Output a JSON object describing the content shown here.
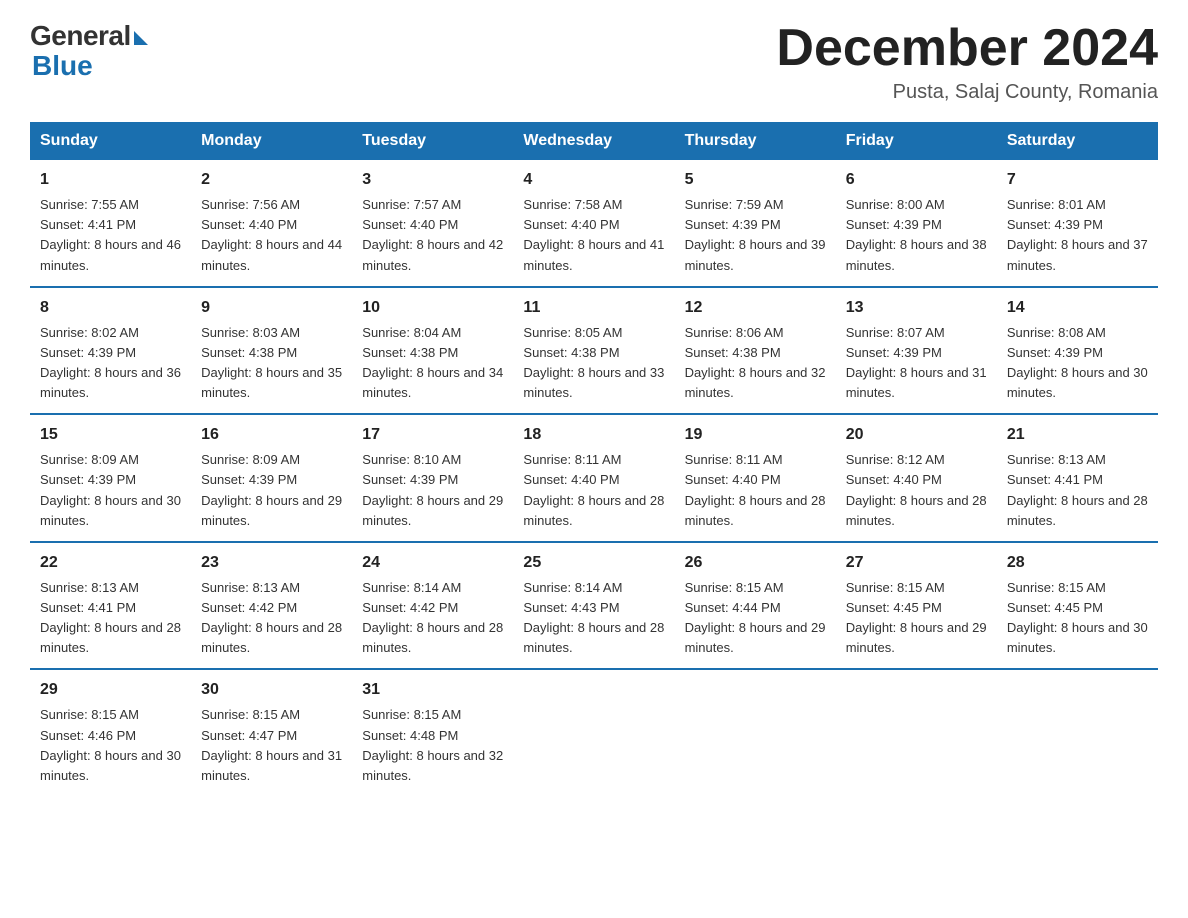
{
  "header": {
    "logo_general": "General",
    "logo_blue": "Blue",
    "month_title": "December 2024",
    "location": "Pusta, Salaj County, Romania"
  },
  "weekdays": [
    "Sunday",
    "Monday",
    "Tuesday",
    "Wednesday",
    "Thursday",
    "Friday",
    "Saturday"
  ],
  "weeks": [
    [
      {
        "day": "1",
        "sunrise": "7:55 AM",
        "sunset": "4:41 PM",
        "daylight": "8 hours and 46 minutes."
      },
      {
        "day": "2",
        "sunrise": "7:56 AM",
        "sunset": "4:40 PM",
        "daylight": "8 hours and 44 minutes."
      },
      {
        "day": "3",
        "sunrise": "7:57 AM",
        "sunset": "4:40 PM",
        "daylight": "8 hours and 42 minutes."
      },
      {
        "day": "4",
        "sunrise": "7:58 AM",
        "sunset": "4:40 PM",
        "daylight": "8 hours and 41 minutes."
      },
      {
        "day": "5",
        "sunrise": "7:59 AM",
        "sunset": "4:39 PM",
        "daylight": "8 hours and 39 minutes."
      },
      {
        "day": "6",
        "sunrise": "8:00 AM",
        "sunset": "4:39 PM",
        "daylight": "8 hours and 38 minutes."
      },
      {
        "day": "7",
        "sunrise": "8:01 AM",
        "sunset": "4:39 PM",
        "daylight": "8 hours and 37 minutes."
      }
    ],
    [
      {
        "day": "8",
        "sunrise": "8:02 AM",
        "sunset": "4:39 PM",
        "daylight": "8 hours and 36 minutes."
      },
      {
        "day": "9",
        "sunrise": "8:03 AM",
        "sunset": "4:38 PM",
        "daylight": "8 hours and 35 minutes."
      },
      {
        "day": "10",
        "sunrise": "8:04 AM",
        "sunset": "4:38 PM",
        "daylight": "8 hours and 34 minutes."
      },
      {
        "day": "11",
        "sunrise": "8:05 AM",
        "sunset": "4:38 PM",
        "daylight": "8 hours and 33 minutes."
      },
      {
        "day": "12",
        "sunrise": "8:06 AM",
        "sunset": "4:38 PM",
        "daylight": "8 hours and 32 minutes."
      },
      {
        "day": "13",
        "sunrise": "8:07 AM",
        "sunset": "4:39 PM",
        "daylight": "8 hours and 31 minutes."
      },
      {
        "day": "14",
        "sunrise": "8:08 AM",
        "sunset": "4:39 PM",
        "daylight": "8 hours and 30 minutes."
      }
    ],
    [
      {
        "day": "15",
        "sunrise": "8:09 AM",
        "sunset": "4:39 PM",
        "daylight": "8 hours and 30 minutes."
      },
      {
        "day": "16",
        "sunrise": "8:09 AM",
        "sunset": "4:39 PM",
        "daylight": "8 hours and 29 minutes."
      },
      {
        "day": "17",
        "sunrise": "8:10 AM",
        "sunset": "4:39 PM",
        "daylight": "8 hours and 29 minutes."
      },
      {
        "day": "18",
        "sunrise": "8:11 AM",
        "sunset": "4:40 PM",
        "daylight": "8 hours and 28 minutes."
      },
      {
        "day": "19",
        "sunrise": "8:11 AM",
        "sunset": "4:40 PM",
        "daylight": "8 hours and 28 minutes."
      },
      {
        "day": "20",
        "sunrise": "8:12 AM",
        "sunset": "4:40 PM",
        "daylight": "8 hours and 28 minutes."
      },
      {
        "day": "21",
        "sunrise": "8:13 AM",
        "sunset": "4:41 PM",
        "daylight": "8 hours and 28 minutes."
      }
    ],
    [
      {
        "day": "22",
        "sunrise": "8:13 AM",
        "sunset": "4:41 PM",
        "daylight": "8 hours and 28 minutes."
      },
      {
        "day": "23",
        "sunrise": "8:13 AM",
        "sunset": "4:42 PM",
        "daylight": "8 hours and 28 minutes."
      },
      {
        "day": "24",
        "sunrise": "8:14 AM",
        "sunset": "4:42 PM",
        "daylight": "8 hours and 28 minutes."
      },
      {
        "day": "25",
        "sunrise": "8:14 AM",
        "sunset": "4:43 PM",
        "daylight": "8 hours and 28 minutes."
      },
      {
        "day": "26",
        "sunrise": "8:15 AM",
        "sunset": "4:44 PM",
        "daylight": "8 hours and 29 minutes."
      },
      {
        "day": "27",
        "sunrise": "8:15 AM",
        "sunset": "4:45 PM",
        "daylight": "8 hours and 29 minutes."
      },
      {
        "day": "28",
        "sunrise": "8:15 AM",
        "sunset": "4:45 PM",
        "daylight": "8 hours and 30 minutes."
      }
    ],
    [
      {
        "day": "29",
        "sunrise": "8:15 AM",
        "sunset": "4:46 PM",
        "daylight": "8 hours and 30 minutes."
      },
      {
        "day": "30",
        "sunrise": "8:15 AM",
        "sunset": "4:47 PM",
        "daylight": "8 hours and 31 minutes."
      },
      {
        "day": "31",
        "sunrise": "8:15 AM",
        "sunset": "4:48 PM",
        "daylight": "8 hours and 32 minutes."
      },
      null,
      null,
      null,
      null
    ]
  ]
}
